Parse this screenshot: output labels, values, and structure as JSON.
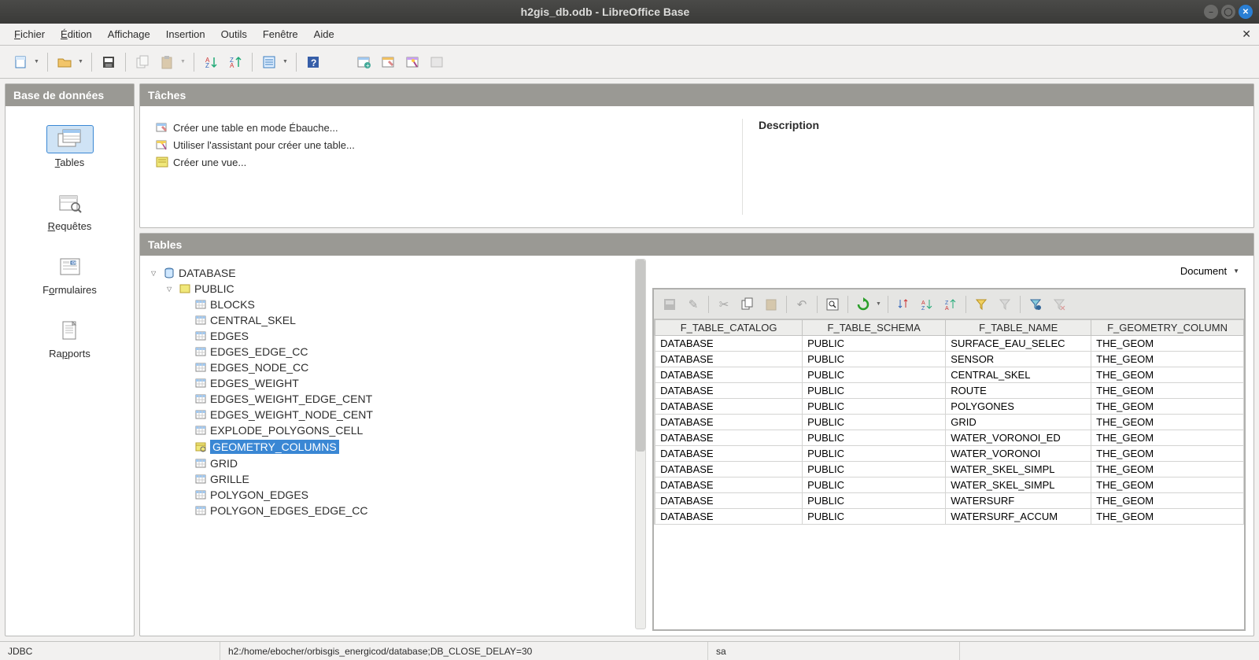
{
  "window": {
    "title": "h2gis_db.odb - LibreOffice Base"
  },
  "menu": {
    "file": "Fichier",
    "edit": "Édition",
    "view": "Affichage",
    "insert": "Insertion",
    "tools": "Outils",
    "window": "Fenêtre",
    "help": "Aide"
  },
  "sidebar": {
    "header": "Base de données",
    "tables": "Tables",
    "queries": "Requêtes",
    "forms": "Formulaires",
    "reports": "Rapports"
  },
  "tasks": {
    "header": "Tâches",
    "t1": "Créer une table en mode Ébauche...",
    "t2": "Utiliser l'assistant pour créer une table...",
    "t3": "Créer une vue...",
    "desc_header": "Description"
  },
  "tables_panel": {
    "header": "Tables"
  },
  "tree": {
    "root": "DATABASE",
    "schema": "PUBLIC",
    "items": [
      "BLOCKS",
      "CENTRAL_SKEL",
      "EDGES",
      "EDGES_EDGE_CC",
      "EDGES_NODE_CC",
      "EDGES_WEIGHT",
      "EDGES_WEIGHT_EDGE_CENT",
      "EDGES_WEIGHT_NODE_CENT",
      "EXPLODE_POLYGONS_CELL",
      "GEOMETRY_COLUMNS",
      "GRID",
      "GRILLE",
      "POLYGON_EDGES",
      "POLYGON_EDGES_EDGE_CC"
    ],
    "selected_index": 9
  },
  "preview": {
    "doc_label": "Document",
    "headers": [
      "F_TABLE_CATALOG",
      "F_TABLE_SCHEMA",
      "F_TABLE_NAME",
      "F_GEOMETRY_COLUMN"
    ],
    "rows": [
      [
        "DATABASE",
        "PUBLIC",
        "SURFACE_EAU_SELEC",
        "THE_GEOM"
      ],
      [
        "DATABASE",
        "PUBLIC",
        "SENSOR",
        "THE_GEOM"
      ],
      [
        "DATABASE",
        "PUBLIC",
        "CENTRAL_SKEL",
        "THE_GEOM"
      ],
      [
        "DATABASE",
        "PUBLIC",
        "ROUTE",
        "THE_GEOM"
      ],
      [
        "DATABASE",
        "PUBLIC",
        "POLYGONES",
        "THE_GEOM"
      ],
      [
        "DATABASE",
        "PUBLIC",
        "GRID",
        "THE_GEOM"
      ],
      [
        "DATABASE",
        "PUBLIC",
        "WATER_VORONOI_ED",
        "THE_GEOM"
      ],
      [
        "DATABASE",
        "PUBLIC",
        "WATER_VORONOI",
        "THE_GEOM"
      ],
      [
        "DATABASE",
        "PUBLIC",
        "WATER_SKEL_SIMPL",
        "THE_GEOM"
      ],
      [
        "DATABASE",
        "PUBLIC",
        "WATER_SKEL_SIMPL",
        "THE_GEOM"
      ],
      [
        "DATABASE",
        "PUBLIC",
        "WATERSURF",
        "THE_GEOM"
      ],
      [
        "DATABASE",
        "PUBLIC",
        "WATERSURF_ACCUM",
        "THE_GEOM"
      ]
    ]
  },
  "status": {
    "driver": "JDBC",
    "conn": "h2:/home/ebocher/orbisgis_energicod/database;DB_CLOSE_DELAY=30",
    "user": "sa"
  }
}
